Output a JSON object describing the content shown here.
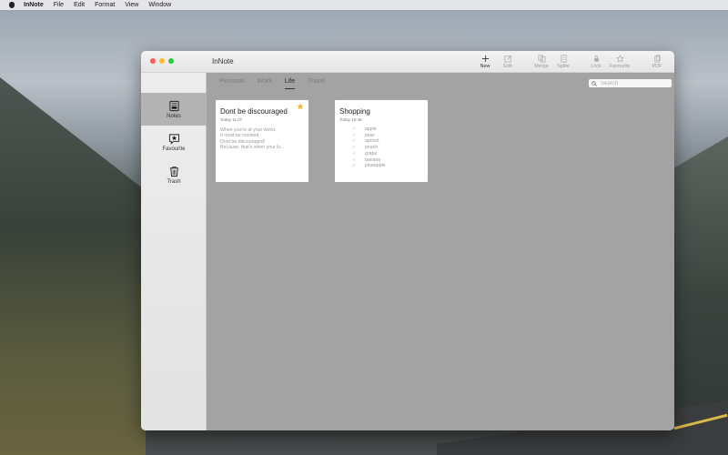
{
  "menubar": {
    "app": "InNote",
    "items": [
      "File",
      "Edit",
      "Format",
      "View",
      "Window"
    ]
  },
  "window": {
    "title": "InNote"
  },
  "toolbar": {
    "buttons": [
      {
        "label": "New",
        "icon": "plus-icon",
        "enabled": true
      },
      {
        "label": "Edit",
        "icon": "edit-icon",
        "enabled": false
      },
      {
        "label": "Merge",
        "icon": "merge-icon",
        "enabled": false
      },
      {
        "label": "Splite",
        "icon": "split-icon",
        "enabled": false
      },
      {
        "label": "Lock",
        "icon": "lock-icon",
        "enabled": false
      },
      {
        "label": "Favourite",
        "icon": "star-icon",
        "enabled": false
      },
      {
        "label": "PDF",
        "icon": "pdf-icon",
        "enabled": false
      }
    ]
  },
  "sidebar": {
    "items": [
      {
        "label": "Notes",
        "icon": "notes-icon",
        "selected": true
      },
      {
        "label": "Favourite",
        "icon": "favourite-icon",
        "selected": false
      },
      {
        "label": "Trash",
        "icon": "trash-icon",
        "selected": false
      }
    ]
  },
  "tabs": [
    "Personal",
    "Work",
    "Life",
    "Travel"
  ],
  "active_tab": "Life",
  "search": {
    "placeholder": "Search",
    "value": ""
  },
  "notes": [
    {
      "title": "Dont be discouraged",
      "date": "Today 11:07",
      "favourite": true,
      "body": [
        "When you're at your worst,",
        "It must be resisted,",
        "Dont be discouraged!",
        "Because,  that's when your lu..."
      ]
    },
    {
      "title": "Shopping",
      "date": "Today 10:46",
      "favourite": false,
      "checklist": [
        "apple",
        "pear",
        "apricot",
        "peach",
        "grape",
        "banana",
        "pineapple"
      ]
    }
  ],
  "colors": {
    "favourite_star": "#f5b731",
    "window_bg": "#a3a3a3",
    "sidebar_selected": "#b3b3b3"
  }
}
